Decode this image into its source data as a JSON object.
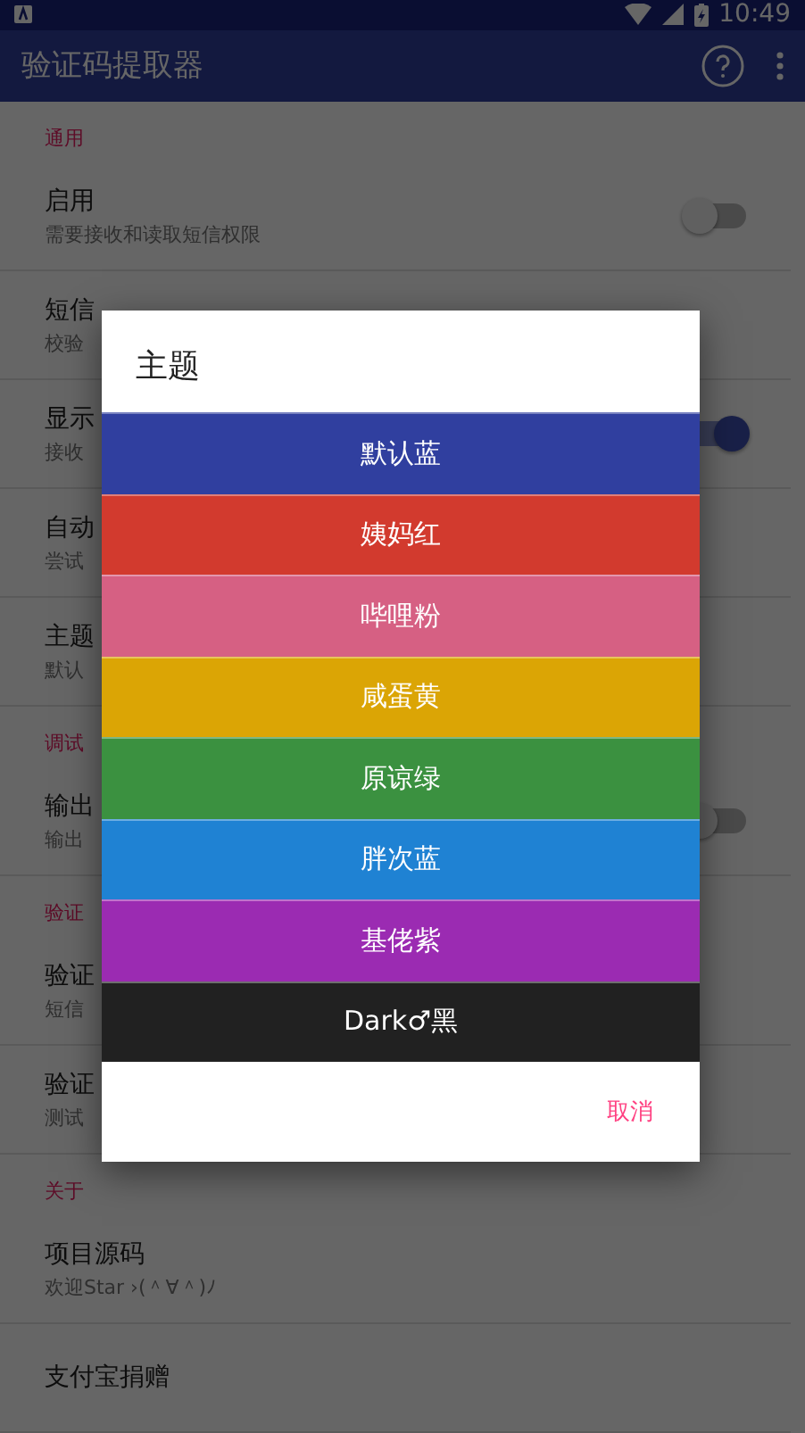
{
  "status_bar": {
    "time": "10:49"
  },
  "app_bar": {
    "title": "验证码提取器"
  },
  "sections": [
    {
      "header": "通用",
      "items": [
        {
          "title": "启用",
          "subtitle": "需要接收和读取短信权限",
          "kind": "switch",
          "on": false
        },
        {
          "title": "短信",
          "subtitle": "校验",
          "kind": "plain"
        },
        {
          "title": "显示",
          "subtitle": "接收",
          "kind": "switch",
          "on": true
        },
        {
          "title": "自动",
          "subtitle": "尝试",
          "kind": "plain"
        },
        {
          "title": "主题",
          "subtitle": "默认",
          "kind": "plain"
        }
      ]
    },
    {
      "header": "调试",
      "items": [
        {
          "title": "输出",
          "subtitle": "输出",
          "kind": "switch",
          "on": false
        }
      ]
    },
    {
      "header": "验证",
      "items": [
        {
          "title": "验证",
          "subtitle": "短信",
          "kind": "plain"
        },
        {
          "title": "验证",
          "subtitle": "测试",
          "kind": "plain"
        }
      ]
    },
    {
      "header": "关于",
      "items": [
        {
          "title": "项目源码",
          "subtitle": "欢迎Star ›(＾∀＾)ﾉ",
          "kind": "plain"
        },
        {
          "title": "支付宝捐赠",
          "kind": "plain"
        }
      ]
    }
  ],
  "dialog": {
    "title": "主题",
    "options": [
      {
        "label": "默认蓝",
        "color": "#303f9f"
      },
      {
        "label": "姨妈红",
        "color": "#d23a2e"
      },
      {
        "label": "哔哩粉",
        "color": "#d66083"
      },
      {
        "label": "咸蛋黄",
        "color": "#dba505"
      },
      {
        "label": "原谅绿",
        "color": "#3b9140"
      },
      {
        "label": "胖次蓝",
        "color": "#1f82d3"
      },
      {
        "label": "基佬紫",
        "color": "#9b2bb2"
      },
      {
        "label": "Dark♂黑",
        "color": "#212121"
      }
    ],
    "cancel": "取消"
  }
}
